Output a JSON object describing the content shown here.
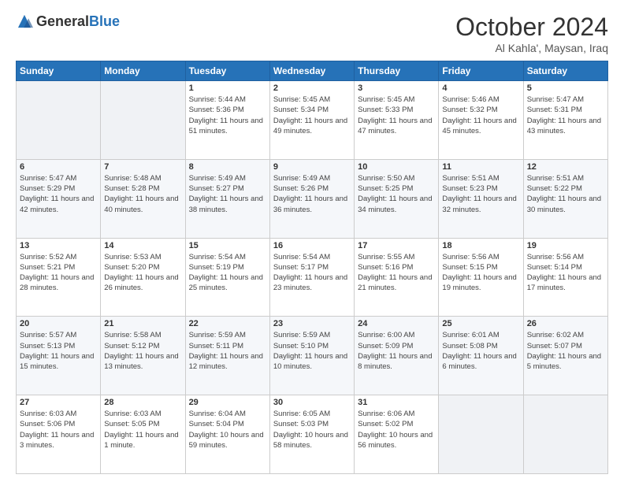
{
  "header": {
    "logo_general": "General",
    "logo_blue": "Blue",
    "month_title": "October 2024",
    "subtitle": "Al Kahla', Maysan, Iraq"
  },
  "days_of_week": [
    "Sunday",
    "Monday",
    "Tuesday",
    "Wednesday",
    "Thursday",
    "Friday",
    "Saturday"
  ],
  "weeks": [
    [
      {
        "day": "",
        "info": ""
      },
      {
        "day": "",
        "info": ""
      },
      {
        "day": "1",
        "info": "Sunrise: 5:44 AM\nSunset: 5:36 PM\nDaylight: 11 hours and 51 minutes."
      },
      {
        "day": "2",
        "info": "Sunrise: 5:45 AM\nSunset: 5:34 PM\nDaylight: 11 hours and 49 minutes."
      },
      {
        "day": "3",
        "info": "Sunrise: 5:45 AM\nSunset: 5:33 PM\nDaylight: 11 hours and 47 minutes."
      },
      {
        "day": "4",
        "info": "Sunrise: 5:46 AM\nSunset: 5:32 PM\nDaylight: 11 hours and 45 minutes."
      },
      {
        "day": "5",
        "info": "Sunrise: 5:47 AM\nSunset: 5:31 PM\nDaylight: 11 hours and 43 minutes."
      }
    ],
    [
      {
        "day": "6",
        "info": "Sunrise: 5:47 AM\nSunset: 5:29 PM\nDaylight: 11 hours and 42 minutes."
      },
      {
        "day": "7",
        "info": "Sunrise: 5:48 AM\nSunset: 5:28 PM\nDaylight: 11 hours and 40 minutes."
      },
      {
        "day": "8",
        "info": "Sunrise: 5:49 AM\nSunset: 5:27 PM\nDaylight: 11 hours and 38 minutes."
      },
      {
        "day": "9",
        "info": "Sunrise: 5:49 AM\nSunset: 5:26 PM\nDaylight: 11 hours and 36 minutes."
      },
      {
        "day": "10",
        "info": "Sunrise: 5:50 AM\nSunset: 5:25 PM\nDaylight: 11 hours and 34 minutes."
      },
      {
        "day": "11",
        "info": "Sunrise: 5:51 AM\nSunset: 5:23 PM\nDaylight: 11 hours and 32 minutes."
      },
      {
        "day": "12",
        "info": "Sunrise: 5:51 AM\nSunset: 5:22 PM\nDaylight: 11 hours and 30 minutes."
      }
    ],
    [
      {
        "day": "13",
        "info": "Sunrise: 5:52 AM\nSunset: 5:21 PM\nDaylight: 11 hours and 28 minutes."
      },
      {
        "day": "14",
        "info": "Sunrise: 5:53 AM\nSunset: 5:20 PM\nDaylight: 11 hours and 26 minutes."
      },
      {
        "day": "15",
        "info": "Sunrise: 5:54 AM\nSunset: 5:19 PM\nDaylight: 11 hours and 25 minutes."
      },
      {
        "day": "16",
        "info": "Sunrise: 5:54 AM\nSunset: 5:17 PM\nDaylight: 11 hours and 23 minutes."
      },
      {
        "day": "17",
        "info": "Sunrise: 5:55 AM\nSunset: 5:16 PM\nDaylight: 11 hours and 21 minutes."
      },
      {
        "day": "18",
        "info": "Sunrise: 5:56 AM\nSunset: 5:15 PM\nDaylight: 11 hours and 19 minutes."
      },
      {
        "day": "19",
        "info": "Sunrise: 5:56 AM\nSunset: 5:14 PM\nDaylight: 11 hours and 17 minutes."
      }
    ],
    [
      {
        "day": "20",
        "info": "Sunrise: 5:57 AM\nSunset: 5:13 PM\nDaylight: 11 hours and 15 minutes."
      },
      {
        "day": "21",
        "info": "Sunrise: 5:58 AM\nSunset: 5:12 PM\nDaylight: 11 hours and 13 minutes."
      },
      {
        "day": "22",
        "info": "Sunrise: 5:59 AM\nSunset: 5:11 PM\nDaylight: 11 hours and 12 minutes."
      },
      {
        "day": "23",
        "info": "Sunrise: 5:59 AM\nSunset: 5:10 PM\nDaylight: 11 hours and 10 minutes."
      },
      {
        "day": "24",
        "info": "Sunrise: 6:00 AM\nSunset: 5:09 PM\nDaylight: 11 hours and 8 minutes."
      },
      {
        "day": "25",
        "info": "Sunrise: 6:01 AM\nSunset: 5:08 PM\nDaylight: 11 hours and 6 minutes."
      },
      {
        "day": "26",
        "info": "Sunrise: 6:02 AM\nSunset: 5:07 PM\nDaylight: 11 hours and 5 minutes."
      }
    ],
    [
      {
        "day": "27",
        "info": "Sunrise: 6:03 AM\nSunset: 5:06 PM\nDaylight: 11 hours and 3 minutes."
      },
      {
        "day": "28",
        "info": "Sunrise: 6:03 AM\nSunset: 5:05 PM\nDaylight: 11 hours and 1 minute."
      },
      {
        "day": "29",
        "info": "Sunrise: 6:04 AM\nSunset: 5:04 PM\nDaylight: 10 hours and 59 minutes."
      },
      {
        "day": "30",
        "info": "Sunrise: 6:05 AM\nSunset: 5:03 PM\nDaylight: 10 hours and 58 minutes."
      },
      {
        "day": "31",
        "info": "Sunrise: 6:06 AM\nSunset: 5:02 PM\nDaylight: 10 hours and 56 minutes."
      },
      {
        "day": "",
        "info": ""
      },
      {
        "day": "",
        "info": ""
      }
    ]
  ]
}
